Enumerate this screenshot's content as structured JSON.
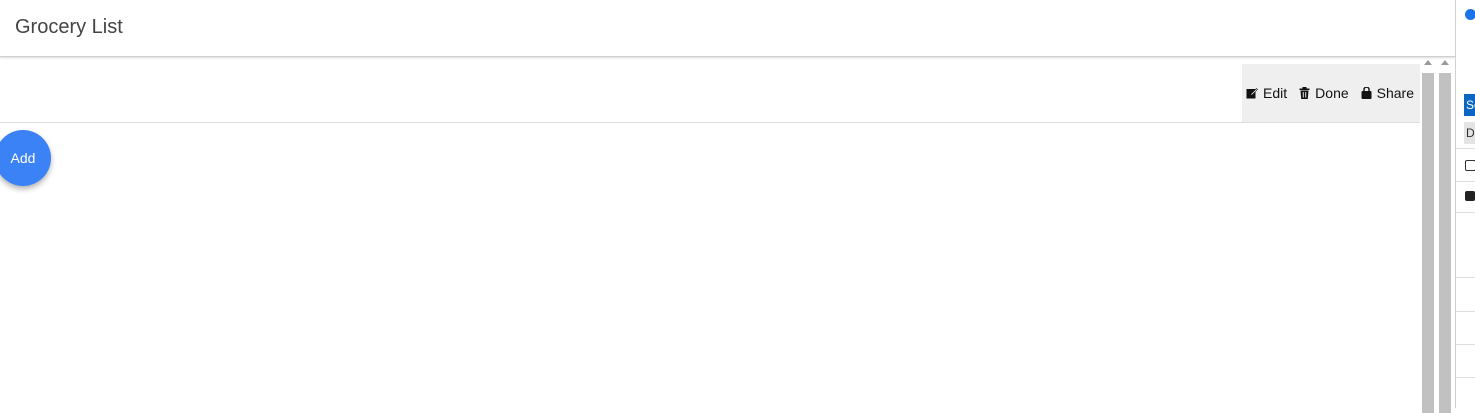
{
  "header": {
    "title": "Grocery List"
  },
  "toolbar": {
    "actions": [
      {
        "label": "Edit",
        "icon": "edit-icon"
      },
      {
        "label": "Done",
        "icon": "trash-icon"
      },
      {
        "label": "Share",
        "icon": "share-icon"
      }
    ]
  },
  "fab": {
    "label": "Add",
    "color": "#3b82f6"
  },
  "sidepanel": {
    "btn1": "Se",
    "btn2": "D"
  }
}
